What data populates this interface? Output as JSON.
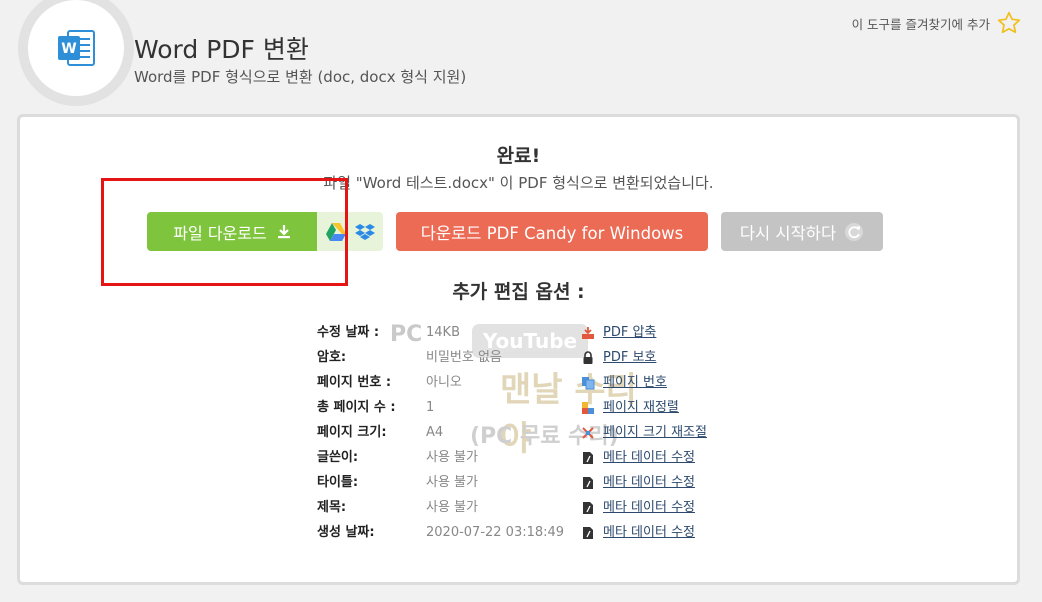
{
  "header": {
    "title": "Word PDF 변환",
    "subtitle": "Word를 PDF 형식으로 변환 (doc, docx 형식 지원)",
    "logo_letter": "W",
    "bookmark_label": "이 도구를 즐겨찾기에 추가"
  },
  "result": {
    "title": "완료!",
    "message": "파일 \"Word 테스트.docx\" 이 PDF 형식으로 변환되었습니다."
  },
  "buttons": {
    "download": "파일 다운로드",
    "windows": "다운로드 PDF Candy for Windows",
    "restart": "다시 시작하다"
  },
  "extra_title": "추가 편집 옵션 :",
  "info": [
    {
      "label": "수정 날짜 :",
      "value": "14KB"
    },
    {
      "label": "암호:",
      "value": "비밀번호 없음"
    },
    {
      "label": "페이지 번호 :",
      "value": "아니오"
    },
    {
      "label": "총 페이지 수 :",
      "value": "1"
    },
    {
      "label": "페이지 크기:",
      "value": "A4"
    },
    {
      "label": "글쓴이:",
      "value": "사용 불가"
    },
    {
      "label": "타이틀:",
      "value": "사용 불가"
    },
    {
      "label": "제목:",
      "value": "사용 불가"
    },
    {
      "label": "생성 날짜:",
      "value": "2020-07-22 03:18:49"
    }
  ],
  "actions": [
    {
      "label": "PDF 압축",
      "icon": "compress-icon"
    },
    {
      "label": "PDF 보호",
      "icon": "lock-icon"
    },
    {
      "label": "페이지 번호",
      "icon": "page-number-icon"
    },
    {
      "label": "페이지 재정렬",
      "icon": "reorder-icon"
    },
    {
      "label": "페이지 크기 재조절",
      "icon": "resize-icon"
    },
    {
      "label": "메타 데이터 수정",
      "icon": "edit-metadata-icon"
    },
    {
      "label": "메타 데이터 수정",
      "icon": "edit-metadata-icon"
    },
    {
      "label": "메타 데이터 수정",
      "icon": "edit-metadata-icon"
    },
    {
      "label": "메타 데이터 수정",
      "icon": "edit-metadata-icon"
    }
  ],
  "watermark": {
    "pc": "PC",
    "youtube": "YouTube",
    "main": "맨날 수리야",
    "sub": "(PC 무료 수리)"
  },
  "colors": {
    "download_green": "#7ec53d",
    "windows_orange": "#ec6b55",
    "restart_gray": "#c4c4c4",
    "link_blue": "#2d4a6e",
    "highlight_red": "#e51515"
  }
}
